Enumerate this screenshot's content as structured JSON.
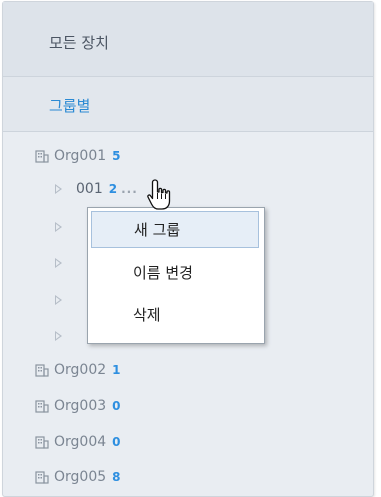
{
  "nav": {
    "all_devices": "모든 장치",
    "by_group": "그룹별"
  },
  "tree": {
    "orgs": [
      {
        "name": "Org001",
        "count": "5"
      },
      {
        "name": "Org002",
        "count": "1"
      },
      {
        "name": "Org003",
        "count": "0"
      },
      {
        "name": "Org004",
        "count": "0"
      },
      {
        "name": "Org005",
        "count": "8"
      }
    ],
    "org001_children": [
      {
        "name": "001",
        "count": "2",
        "more": "..."
      }
    ]
  },
  "context_menu": {
    "items": [
      {
        "label": "새 그룹"
      },
      {
        "label": "이름 변경"
      },
      {
        "label": "삭제"
      }
    ]
  },
  "colors": {
    "accent": "#2b8ad3",
    "count": "#2e8fe0",
    "panel_bg": "#e9edf2"
  },
  "icons": {
    "org": "building-icon",
    "expand": "expand-triangle-icon",
    "cursor": "hand-pointer-icon"
  }
}
